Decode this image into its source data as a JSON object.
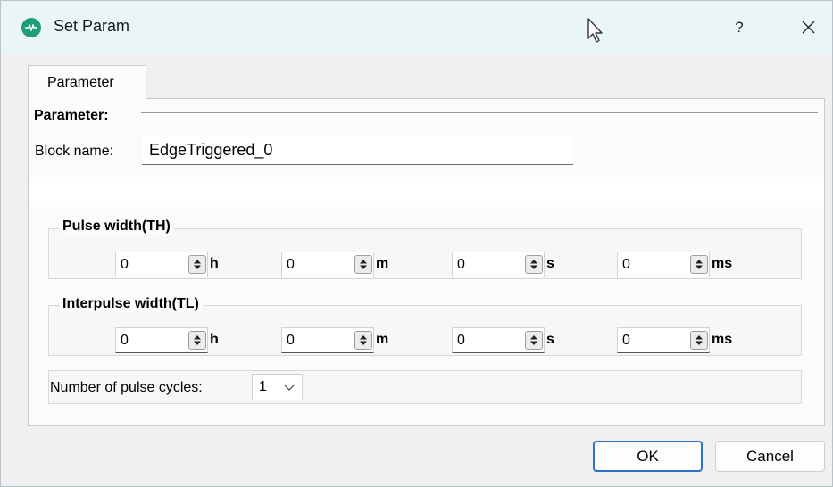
{
  "window": {
    "title": "Set Param",
    "help_label": "?"
  },
  "tabs": [
    {
      "label": "Parameter"
    }
  ],
  "section": {
    "title": "Parameter:"
  },
  "block_name": {
    "label": "Block name:",
    "value": "EdgeTriggered_0"
  },
  "pulse_width": {
    "title": "Pulse width(TH)",
    "fields": [
      {
        "value": "0",
        "unit": "h"
      },
      {
        "value": "0",
        "unit": "m"
      },
      {
        "value": "0",
        "unit": "s"
      },
      {
        "value": "0",
        "unit": "ms"
      }
    ]
  },
  "interpulse_width": {
    "title": "Interpulse width(TL)",
    "fields": [
      {
        "value": "0",
        "unit": "h"
      },
      {
        "value": "0",
        "unit": "m"
      },
      {
        "value": "0",
        "unit": "s"
      },
      {
        "value": "0",
        "unit": "ms"
      }
    ]
  },
  "pulse_cycles": {
    "label": "Number of pulse cycles:",
    "value": "1"
  },
  "buttons": {
    "ok": "OK",
    "cancel": "Cancel"
  },
  "colors": {
    "accent": "#2a72c6",
    "titlebar": "#e9f5f6",
    "app_icon": "#1f9e77"
  }
}
